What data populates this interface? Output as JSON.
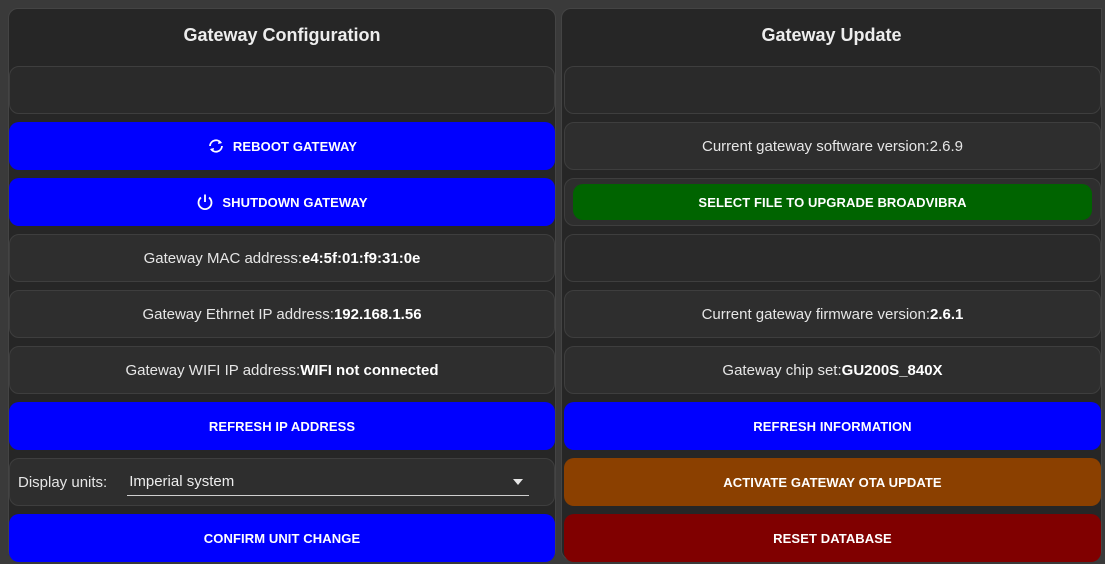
{
  "left_panel": {
    "title": "Gateway Configuration",
    "reboot_label": "REBOOT GATEWAY",
    "shutdown_label": "SHUTDOWN GATEWAY",
    "mac_label": "Gateway MAC address: ",
    "mac_value": "e4:5f:01:f9:31:0e",
    "eth_label": "Gateway Ethrnet IP address: ",
    "eth_value": "192.168.1.56",
    "wifi_label": "Gateway WIFI IP address: ",
    "wifi_value": "WIFI not connected",
    "refresh_ip_label": "REFRESH IP ADDRESS",
    "units_label": "Display units:",
    "units_value": "Imperial system",
    "confirm_label": "CONFIRM UNIT CHANGE"
  },
  "right_panel": {
    "title": "Gateway Update",
    "software_label": "Current gateway software version: ",
    "software_value": "2.6.9",
    "select_file_label": "SELECT FILE TO UPGRADE BROADVIBRA",
    "firmware_label": "Current gateway firmware version: ",
    "firmware_value": "2.6.1",
    "chip_label": "Gateway chip set: ",
    "chip_value": "GU200S_840X",
    "refresh_info_label": "REFRESH INFORMATION",
    "ota_label": "ACTIVATE GATEWAY OTA UPDATE",
    "reset_label": "RESET DATABASE"
  },
  "colors": {
    "blue": "#0000ff",
    "green": "#006400",
    "orange": "#8b4000",
    "red": "#800000"
  },
  "icons": {
    "reboot": "refresh-icon",
    "shutdown": "power-icon",
    "dropdown": "caret-down-icon"
  }
}
